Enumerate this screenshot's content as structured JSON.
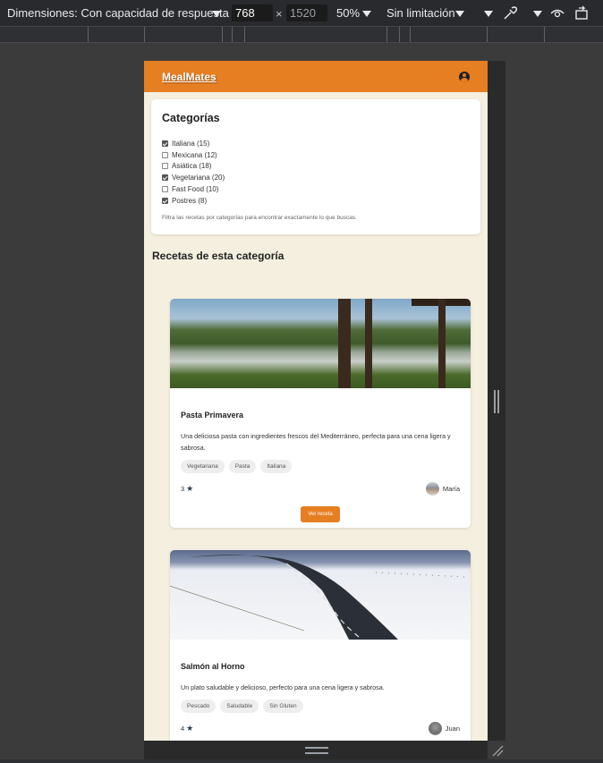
{
  "devtools": {
    "dimensions_label": "Dimensiones: Con capacidad de respuesta",
    "width_value": "768",
    "height_value": "1520",
    "zoom": "50%",
    "throttle": "Sin limitación"
  },
  "app": {
    "brand": "MealMates"
  },
  "filters": {
    "title": "Categorías",
    "hint": "Filtra las recetas por categorías para encontrar exactamente lo que buscas.",
    "categories": [
      {
        "label": "Italiana (15)",
        "checked": true
      },
      {
        "label": "Mexicana (12)",
        "checked": false
      },
      {
        "label": "Asiática (18)",
        "checked": false
      },
      {
        "label": "Vegetariana (20)",
        "checked": true
      },
      {
        "label": "Fast Food (10)",
        "checked": false
      },
      {
        "label": "Postres (8)",
        "checked": true
      }
    ]
  },
  "section_title": "Recetas de esta categoría",
  "recipes": [
    {
      "name": "Pasta Primavera",
      "description": "Una deliciosa pasta con ingredientes frescos del Mediterráneo, perfecta para una cena ligera y sabrosa.",
      "tags": [
        "Vegetariana",
        "Pasta",
        "Italiana"
      ],
      "rating": "3",
      "author": "María",
      "button": "Ver receta"
    },
    {
      "name": "Salmón al Horno",
      "description": "Un plato saludable y delicioso, perfecto para una cena ligera y sabrosa.",
      "tags": [
        "Pescado",
        "Saludable",
        "Sin Gluten"
      ],
      "rating": "4",
      "author": "Juan"
    }
  ]
}
